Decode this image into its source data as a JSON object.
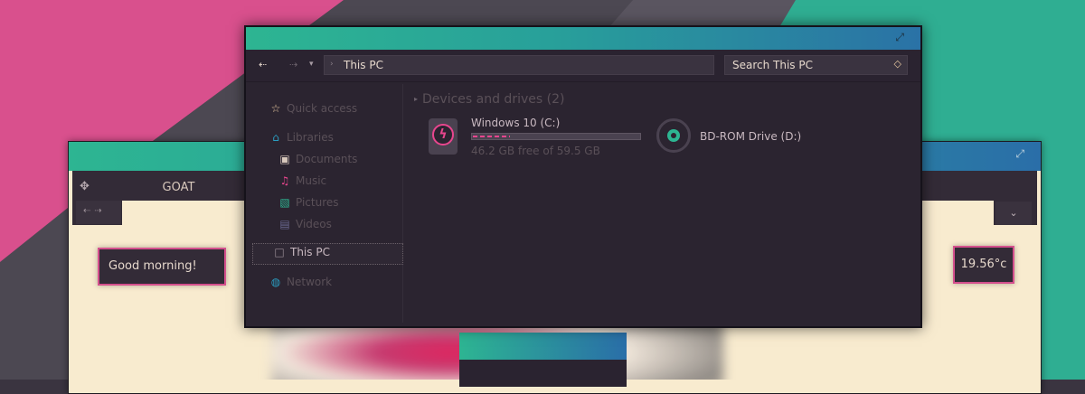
{
  "colors": {
    "accent_pink": "#e8468e",
    "accent_teal": "#2db592",
    "accent_blue": "#2a72a6",
    "window_bg": "#2b2430",
    "cream": "#f8ebcf"
  },
  "background_window": {
    "title": "GOAT",
    "move_icon": "move-icon",
    "nav_glyphs": "⇠⇢",
    "dropdown_icon": "chevron-down-icon",
    "greeting": "Good morning!",
    "temperature": "19.56°c"
  },
  "explorer": {
    "toolbar": {
      "back_icon": "arrow-left-icon",
      "forward_icon": "arrow-right-icon",
      "recent_icon": "chevron-down-icon",
      "address_chevron": "chevron-right-icon",
      "address_text": "This PC",
      "search_placeholder": "Search This PC",
      "search_icon": "search-icon"
    },
    "sidebar": {
      "items": [
        {
          "label": "Quick access",
          "icon": "star-icon"
        },
        {
          "label": "Libraries",
          "icon": "library-icon"
        },
        {
          "label": "Documents",
          "icon": "document-icon"
        },
        {
          "label": "Music",
          "icon": "music-icon"
        },
        {
          "label": "Pictures",
          "icon": "picture-icon"
        },
        {
          "label": "Videos",
          "icon": "video-icon"
        },
        {
          "label": "This PC",
          "icon": "computer-icon",
          "selected": true
        },
        {
          "label": "Network",
          "icon": "network-icon"
        }
      ]
    },
    "main": {
      "group_title": "Devices and drives (2)",
      "drives": [
        {
          "name": "Windows 10 (C:)",
          "free_text": "46.2 GB free of 59.5 GB",
          "used_fraction": 0.22,
          "icon": "hard-drive-icon"
        },
        {
          "name": "BD-ROM Drive (D:)",
          "icon": "optical-drive-icon"
        }
      ]
    }
  }
}
